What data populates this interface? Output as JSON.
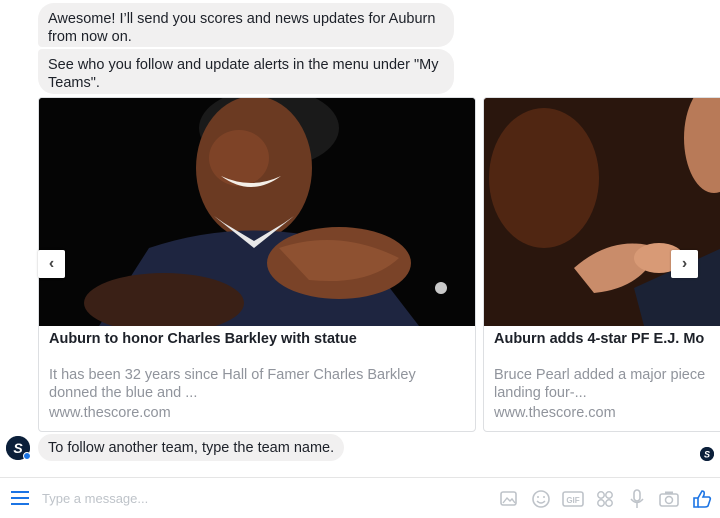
{
  "messages": {
    "m1": "Awesome! I’ll send you scores and news updates for Auburn from now on.",
    "m2": "See who you follow and update alerts in the menu under \"My Teams\".",
    "m3": "To follow another team, type the team name."
  },
  "cards": [
    {
      "title": "Auburn to honor Charles Barkley with statue",
      "description": "It has been 32 years since Hall of Famer Charles Barkley donned the blue and ...",
      "source": "www.thescore.com"
    },
    {
      "title": "Auburn adds 4-star PF E.J. Mo",
      "description": "Bruce Pearl added a major piece landing four-...",
      "source": "www.thescore.com"
    }
  ],
  "composer": {
    "placeholder": "Type a message..."
  },
  "nav": {
    "prev": "‹",
    "next": "›"
  },
  "colors": {
    "accent": "#1b74e4",
    "bubble": "#f1f0f0"
  }
}
